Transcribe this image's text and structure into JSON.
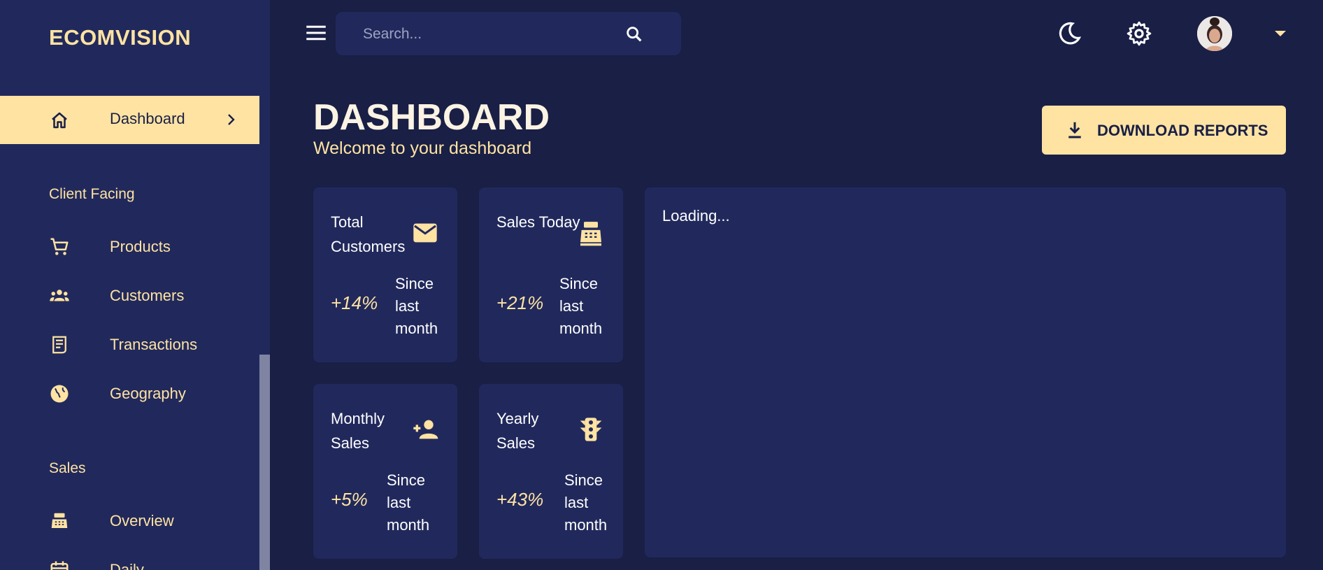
{
  "app": {
    "brand": "ECOMVISION"
  },
  "sidebar": {
    "active": {
      "label": "Dashboard",
      "icon": "home-icon"
    },
    "sections": [
      {
        "title": "Client Facing",
        "items": [
          {
            "label": "Products",
            "icon": "shopping-cart-icon"
          },
          {
            "label": "Customers",
            "icon": "groups-icon"
          },
          {
            "label": "Transactions",
            "icon": "receipt-icon"
          },
          {
            "label": "Geography",
            "icon": "globe-icon"
          }
        ]
      },
      {
        "title": "Sales",
        "items": [
          {
            "label": "Overview",
            "icon": "point-of-sale-icon"
          },
          {
            "label": "Daily",
            "icon": "calendar-icon"
          }
        ]
      }
    ]
  },
  "topbar": {
    "search_placeholder": "Search...",
    "icons": [
      "menu-icon",
      "search-icon",
      "dark-mode-icon",
      "settings-icon",
      "avatar",
      "dropdown-caret-icon"
    ]
  },
  "header": {
    "title": "DASHBOARD",
    "subtitle": "Welcome to your dashboard",
    "download_label": "DOWNLOAD REPORTS"
  },
  "stats": [
    {
      "title": "Total Customers",
      "change": "+14%",
      "since": "Since last month",
      "icon": "email-icon"
    },
    {
      "title": "Sales Today",
      "change": "+21%",
      "since": "Since last month",
      "icon": "point-of-sale-icon"
    },
    {
      "title": "Monthly Sales",
      "change": "+5%",
      "since": "Since last month",
      "icon": "person-add-icon"
    },
    {
      "title": "Yearly Sales",
      "change": "+43%",
      "since": "Since last month",
      "icon": "traffic-icon"
    }
  ],
  "chart_panel": {
    "status": "Loading..."
  },
  "colors": {
    "background": "#191f45",
    "panel": "#21295c",
    "accent": "#ffe3a3",
    "text": "#ffffff"
  }
}
